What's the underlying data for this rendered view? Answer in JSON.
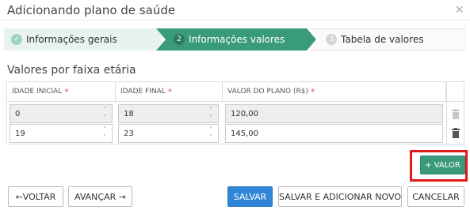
{
  "dialog": {
    "title": "Adicionando plano de saúde",
    "close_glyph": "×"
  },
  "steps": [
    {
      "number": "✓",
      "label": "Informações gerais",
      "state": "done"
    },
    {
      "number": "2",
      "label": "Informações valores",
      "state": "active"
    },
    {
      "number": "3",
      "label": "Tabela de valores",
      "state": "next"
    }
  ],
  "section": {
    "title": "Valores por faixa etária"
  },
  "table": {
    "headers": [
      {
        "label": "IDADE INICIAL",
        "required": "*"
      },
      {
        "label": "IDADE FINAL",
        "required": "*"
      },
      {
        "label": "VALOR DO PLANO (R$)",
        "required": "*"
      }
    ],
    "rows": [
      {
        "idade_inicial": "0",
        "idade_final": "18",
        "valor": "120,00",
        "readonly": true
      },
      {
        "idade_inicial": "19",
        "idade_final": "23",
        "valor": "145,00",
        "readonly": false
      }
    ]
  },
  "actions": {
    "add_value": "+ VALOR",
    "back": "←VOLTAR",
    "next": "AVANÇAR →",
    "save": "SALVAR",
    "save_add": "SALVAR E ADICIONAR NOVO",
    "cancel": "CANCELAR"
  },
  "icons": {
    "spinner_up": "˄",
    "spinner_down": "˅",
    "trash": "trash-icon"
  },
  "colors": {
    "accent_green": "#3a9a7c",
    "primary_blue": "#2f86d6",
    "required_red": "#d9534f",
    "highlight_red": "#e01b1b"
  }
}
